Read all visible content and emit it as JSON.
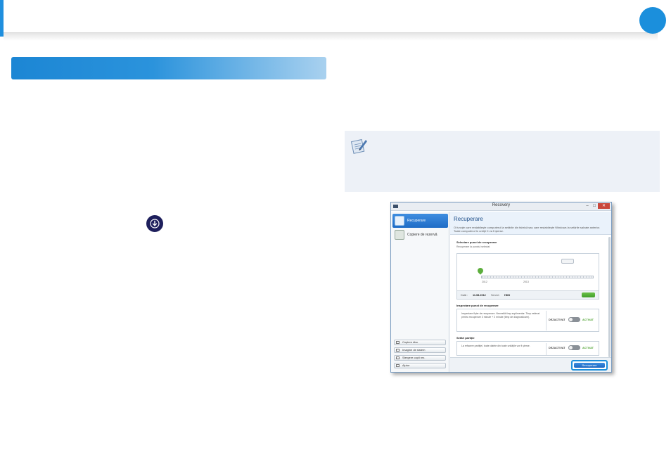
{
  "recovery_window": {
    "title": "Recovery",
    "controls": {
      "minimize": "–",
      "maximize": "□",
      "close": "✕"
    },
    "sidebar": {
      "items": [
        {
          "label": "Recuperare",
          "icon": "recovery-icon"
        },
        {
          "label": "Copiere de rezervă",
          "icon": "backup-disk-icon"
        }
      ],
      "buttons": [
        {
          "label": "Copiere disc"
        },
        {
          "label": "Imagine de sistem"
        },
        {
          "label": "Ștergere copii rez."
        },
        {
          "label": "Ajutor"
        }
      ]
    },
    "main": {
      "title": "Recuperare",
      "description": "O funcţie care restabileşte computerul la setările din fabrică sau care restabileşte Windows la setările salvate anterior. Toate computerul în unitţii C va fi şterse.",
      "restore_point": {
        "heading": "Selectare punct de recuperare",
        "subheading": "Recuperare la punctul selectat",
        "timeline_labels": [
          "2012",
          "2013"
        ],
        "date_label": "Dată :",
        "date_value": "11.08.2012",
        "type_label": "Servid :",
        "type_value": "HDD"
      },
      "inspection": {
        "heading": "Inspectare punct de recuperare",
        "text": "Inspectare fişier de recuperare. Necesită timp suplimentar. Timp estimat pentru recuperare 3 minute + 2 minute (timp de diagnosticare).",
        "off_label": "DEZACTIVAT",
        "on_label": "ACTIVAT"
      },
      "partition": {
        "heading": "Setări partiţie",
        "text": "La refacere partiţiei, toate datele din toate unităţile vor fi şterse.",
        "off_label": "DEZACTIVAT",
        "on_label": "ACTIVAT"
      },
      "recover_button": "Recuperare"
    }
  },
  "colors": {
    "accent_blue": "#1b8fdc",
    "navy_icon": "#1e1f5c",
    "note_background": "#edf1f7"
  },
  "icons": {
    "down_arrow": "down-arrow-circle-icon",
    "note": "note-pencil-icon"
  }
}
